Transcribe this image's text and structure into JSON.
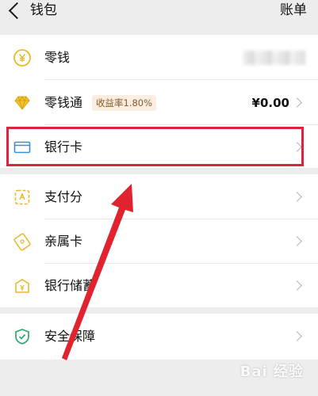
{
  "header": {
    "title": "钱包",
    "bill_label": "账单"
  },
  "rows": [
    {
      "label": "零钱",
      "icon": "coin-icon"
    },
    {
      "label": "零钱通",
      "badge": "收益率1.80%",
      "amount": "¥0.00",
      "icon": "diamond-icon"
    },
    {
      "label": "银行卡",
      "icon": "bank-card-icon"
    },
    {
      "label": "支付分",
      "icon": "pay-score-icon"
    },
    {
      "label": "亲属卡",
      "icon": "family-card-icon"
    },
    {
      "label": "银行储蓄",
      "icon": "bank-savings-icon"
    },
    {
      "label": "安全保障",
      "icon": "shield-check-icon"
    }
  ],
  "colors": {
    "accent_gold": "#e9b92f",
    "highlight_red": "#d7263d",
    "card_blue": "#3a8ed8",
    "shield_green": "#2ba86b"
  },
  "watermark": "Bai 经验"
}
